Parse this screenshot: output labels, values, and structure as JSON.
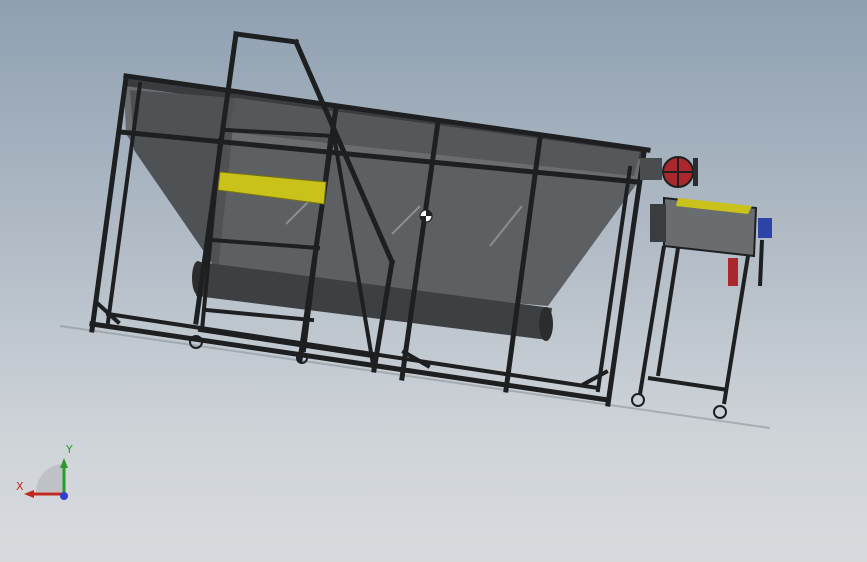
{
  "viewport": {
    "background_top": "#8fa0b1",
    "background_bottom": "#d8dbde"
  },
  "model": {
    "frame_color": "#1e1f21",
    "hopper_color": "#5d6063",
    "hopper_dark_color": "#4a4d50",
    "accent_panel_color": "#c8c21a",
    "valve_color": "#a8282c",
    "motor_color": "#2e43a8"
  },
  "triad": {
    "x_label": "X",
    "y_label": "Y",
    "x_color": "#c0281f",
    "y_color": "#2c9a2c",
    "z_color": "#2f3fd0"
  },
  "cursor": {
    "icon": "rotate-view-cursor-icon"
  }
}
